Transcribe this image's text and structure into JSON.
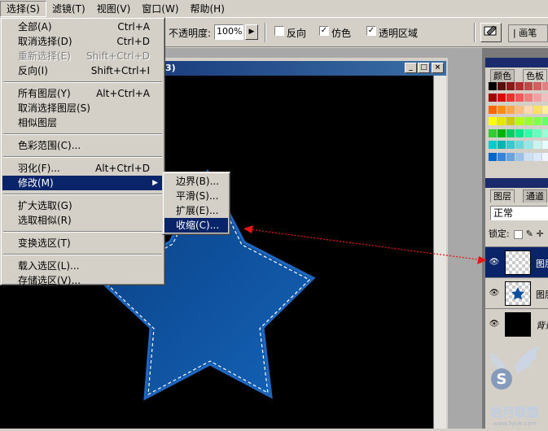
{
  "menubar": {
    "items": [
      "选择(S)",
      "滤镜(T)",
      "视图(V)",
      "窗口(W)",
      "帮助(H)"
    ]
  },
  "options": {
    "opacity_label": "不透明度:",
    "opacity_value": "100%",
    "reverse_label": "反向",
    "dither_label": "仿色",
    "transparency_label": "透明区域",
    "palette_tab": "画笔"
  },
  "select_menu": {
    "all": {
      "label": "全部(A)",
      "shortcut": "Ctrl+A"
    },
    "deselect": {
      "label": "取消选择(D)",
      "shortcut": "Ctrl+D"
    },
    "reselect": {
      "label": "重新选择(E)",
      "shortcut": "Shift+Ctrl+D"
    },
    "inverse": {
      "label": "反向(I)",
      "shortcut": "Shift+Ctrl+I"
    },
    "all_layers": {
      "label": "所有图层(Y)",
      "shortcut": "Alt+Ctrl+A"
    },
    "deselect_layers": {
      "label": "取消选择图层(S)"
    },
    "similar_layers": {
      "label": "相似图层"
    },
    "color_range": {
      "label": "色彩范围(C)..."
    },
    "feather": {
      "label": "羽化(F)...",
      "shortcut": "Alt+Ctrl+D"
    },
    "modify": {
      "label": "修改(M)"
    },
    "grow": {
      "label": "扩大选取(G)"
    },
    "similar": {
      "label": "选取相似(R)"
    },
    "transform": {
      "label": "变换选区(T)"
    },
    "load": {
      "label": "载入选区(L)..."
    },
    "save": {
      "label": "存储选区(V)..."
    }
  },
  "modify_submenu": {
    "border": "边界(B)...",
    "smooth": "平滑(S)...",
    "expand": "扩展(E)...",
    "contract": "收缩(C)..."
  },
  "document": {
    "title_fragment": "3)"
  },
  "panels": {
    "color_tab": "颜色",
    "swatches_tab": "色板",
    "layers_tab": "图层",
    "channels_tab": "通道",
    "blend_mode": "正常",
    "lock_label": "锁定:",
    "layers": [
      {
        "name": "图层",
        "selected": true
      },
      {
        "name": "图层",
        "selected": false
      },
      {
        "name": "背景",
        "selected": false
      }
    ]
  },
  "watermark": {
    "text": "岩月联盟",
    "url": "www.5yue.com"
  },
  "colors": {
    "menu_highlight": "#0a246a",
    "star_fill": "#0d4f9c",
    "annotation_arrow": "#e01818"
  }
}
